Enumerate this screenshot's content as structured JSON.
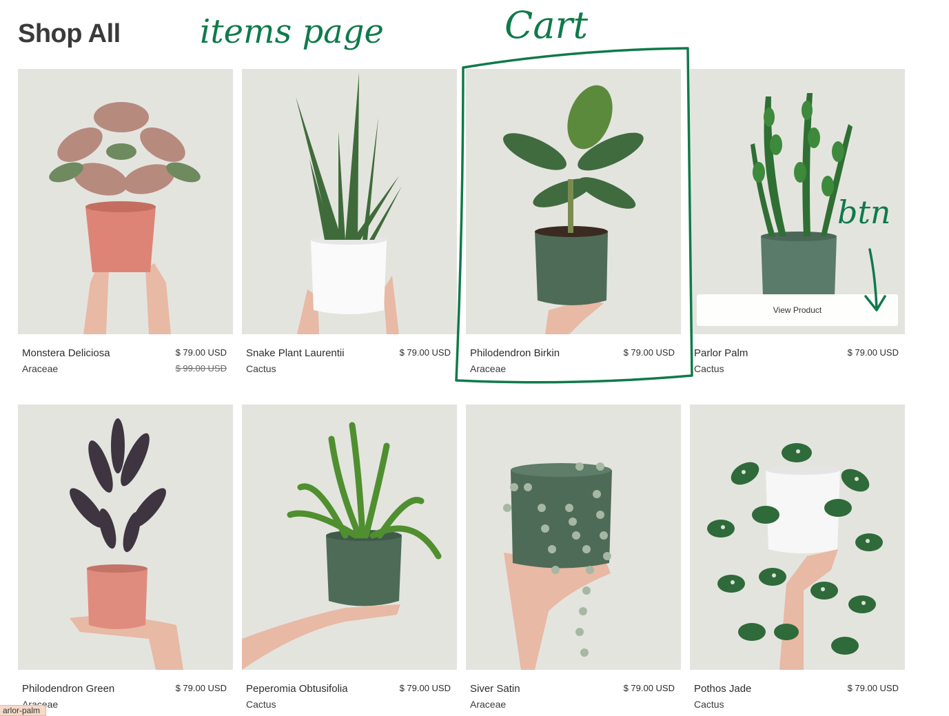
{
  "page": {
    "title": "Shop All"
  },
  "products": [
    {
      "name": "Monstera Deliciosa",
      "category": "Araceae",
      "price": "$ 79.00 USD",
      "old_price": "$ 99.00 USD"
    },
    {
      "name": "Snake Plant Laurentii",
      "category": "Cactus",
      "price": "$ 79.00 USD"
    },
    {
      "name": "Philodendron Birkin",
      "category": "Araceae",
      "price": "$ 79.00 USD"
    },
    {
      "name": "Parlor Palm",
      "category": "Cactus",
      "price": "$ 79.00 USD",
      "hover_button": "View Product"
    },
    {
      "name": "Philodendron Green",
      "category": "Araceae",
      "price": "$ 79.00 USD"
    },
    {
      "name": "Peperomia Obtusifolia",
      "category": "Cactus",
      "price": "$ 79.00 USD"
    },
    {
      "name": "Siver Satin",
      "category": "Araceae",
      "price": "$ 79.00 USD"
    },
    {
      "name": "Pothos Jade",
      "category": "Cactus",
      "price": "$ 79.00 USD"
    }
  ],
  "status_chip": "arlor-palm",
  "annotations": {
    "items_page": "items page",
    "cart": "Cart",
    "btn": "btn",
    "color": "#0f7a4a"
  }
}
